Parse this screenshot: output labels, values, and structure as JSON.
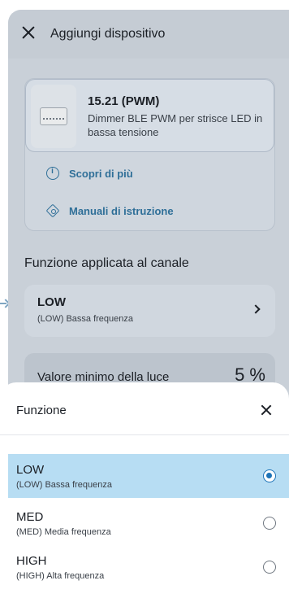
{
  "header": {
    "title": "Aggiungi dispositivo"
  },
  "device": {
    "name": "15.21 (PWM)",
    "description": "Dimmer BLE PWM per strisce LED in bassa tensione",
    "links": [
      {
        "label": "Scopri di più",
        "icon": "info-icon"
      },
      {
        "label": "Manuali di istruzione",
        "icon": "manual-icon"
      }
    ]
  },
  "channel_section": {
    "title": "Funzione applicata al canale",
    "selected_name": "LOW",
    "selected_desc": "(LOW) Bassa frequenza"
  },
  "min_light": {
    "label": "Valore minimo della luce",
    "value": "5 %"
  },
  "sheet": {
    "title": "Funzione",
    "options": [
      {
        "name": "LOW",
        "desc": "(LOW) Bassa frequenza",
        "selected": true
      },
      {
        "name": "MED",
        "desc": "(MED) Media frequenza",
        "selected": false
      },
      {
        "name": "HIGH",
        "desc": "(HIGH) Alta frequenza",
        "selected": false
      }
    ]
  },
  "colors": {
    "accent": "#1d73b7",
    "link": "#2f6f98",
    "selected_bg": "#b7ddf3"
  }
}
